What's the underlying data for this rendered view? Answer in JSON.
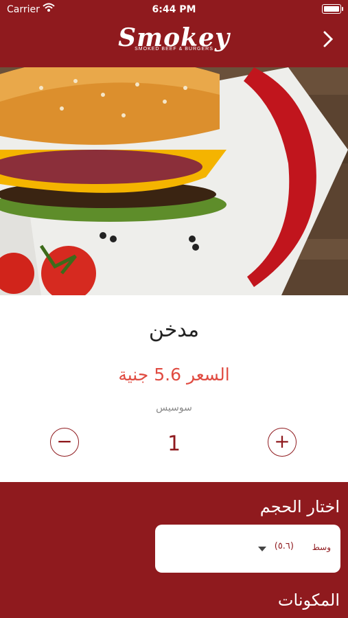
{
  "status": {
    "carrier": "Carrier",
    "time": "6:44 PM"
  },
  "brand": {
    "name": "Smokey",
    "tagline": "SMOKED BEEF & BURGERS"
  },
  "product": {
    "name": "مدخن",
    "price": "السعر 5.6 جنية",
    "description": "سوسيس",
    "quantity": "1",
    "decrease": "−",
    "increase": "+"
  },
  "options": {
    "size_title": "اختار الحجم",
    "size_label": "وسط",
    "size_price": "(٥.٦)",
    "ingredients_title": "المكونات"
  },
  "colors": {
    "brand": "#8f1a1e",
    "price": "#e04b41"
  },
  "icons": [
    "wifi-icon",
    "battery-icon",
    "chevron-right-icon",
    "minus-icon",
    "plus-icon",
    "caret-down-icon"
  ]
}
